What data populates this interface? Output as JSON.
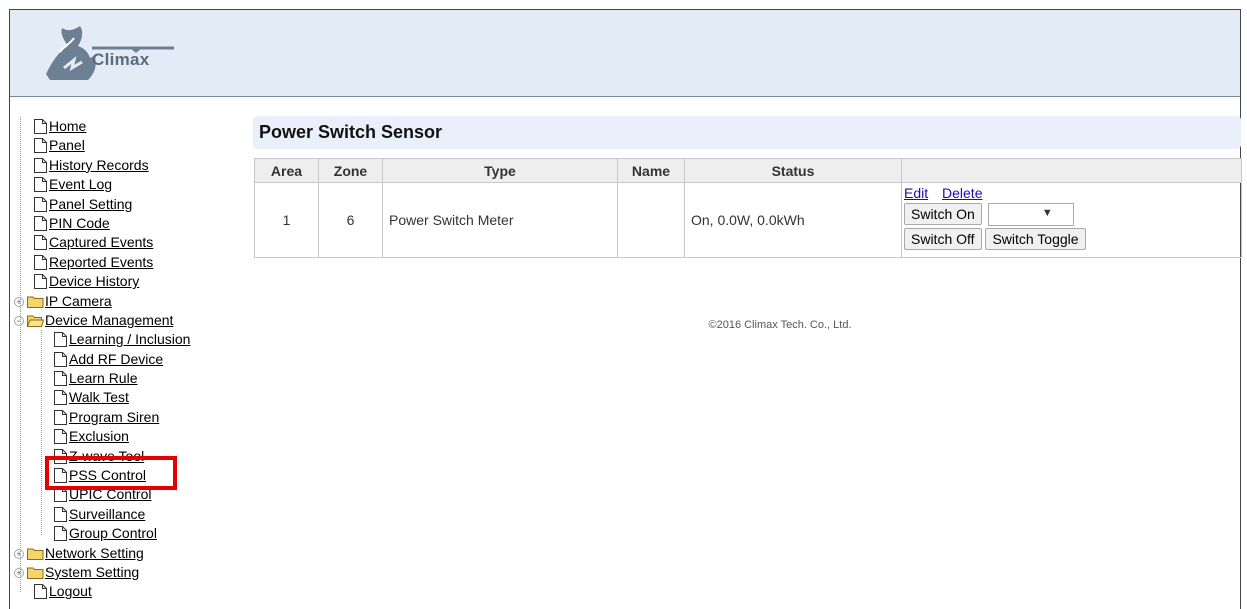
{
  "brand": {
    "name": "Climax"
  },
  "sidebar": {
    "items": [
      {
        "label": "Home",
        "level": 0
      },
      {
        "label": "Panel",
        "level": 0
      },
      {
        "label": "History Records",
        "level": 0
      },
      {
        "label": "Event Log",
        "level": 0
      },
      {
        "label": "Panel Setting",
        "level": 0
      },
      {
        "label": "PIN Code",
        "level": 0
      },
      {
        "label": "Captured Events",
        "level": 0
      },
      {
        "label": "Reported Events",
        "level": 0
      },
      {
        "label": "Device History",
        "level": 0
      },
      {
        "label": "IP Camera",
        "level": 0,
        "folder": true,
        "expander": "+"
      },
      {
        "label": "Device Management",
        "level": 0,
        "folder": true,
        "expander": "−",
        "open": true
      },
      {
        "label": "Learning / Inclusion",
        "level": 1
      },
      {
        "label": "Add RF Device",
        "level": 1
      },
      {
        "label": "Learn Rule",
        "level": 1
      },
      {
        "label": "Walk Test",
        "level": 1
      },
      {
        "label": "Program Siren",
        "level": 1
      },
      {
        "label": "Exclusion",
        "level": 1
      },
      {
        "label": "Z-wave Tool",
        "level": 1
      },
      {
        "label": "PSS Control",
        "level": 1,
        "highlighted": true
      },
      {
        "label": "UPIC Control",
        "level": 1
      },
      {
        "label": "Surveillance",
        "level": 1
      },
      {
        "label": "Group Control",
        "level": 1
      },
      {
        "label": "Network Setting",
        "level": 0,
        "folder": true,
        "expander": "+"
      },
      {
        "label": "System Setting",
        "level": 0,
        "folder": true,
        "expander": "+"
      },
      {
        "label": "Logout",
        "level": 0
      }
    ]
  },
  "main": {
    "title": "Power Switch Sensor",
    "columns": [
      "Area",
      "Zone",
      "Type",
      "Name",
      "Status",
      ""
    ],
    "rows": [
      {
        "area": "1",
        "zone": "6",
        "type": "Power Switch Meter",
        "name": "",
        "status": "On, 0.0W, 0.0kWh"
      }
    ],
    "actions": {
      "edit": "Edit",
      "delete": "Delete",
      "switch_on": "Switch On",
      "switch_off": "Switch Off",
      "switch_toggle": "Switch Toggle",
      "select_value": ""
    }
  },
  "footer": {
    "copyright": "©2016 Climax Tech. Co., Ltd."
  },
  "colors": {
    "header_bg": "#e3ecf6",
    "title_bg": "#e9f0fb",
    "highlight": "#e60000",
    "link": "#1a0dab"
  }
}
